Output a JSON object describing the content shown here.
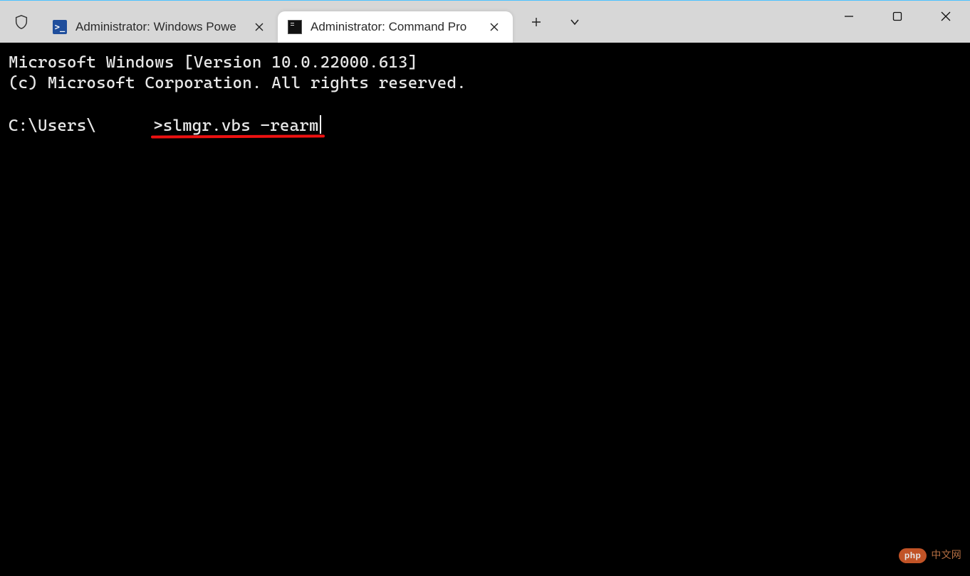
{
  "tabs": {
    "inactive": {
      "label": "Administrator: Windows Powe"
    },
    "active": {
      "label": "Administrator: Command Pro"
    }
  },
  "terminal": {
    "line1": "Microsoft Windows [Version 10.0.22000.613]",
    "line2": "(c) Microsoft Corporation. All rights reserved.",
    "prompt_prefix": "C:\\Users\\",
    "prompt_suffix": ">",
    "command": "slmgr.vbs -rearm"
  },
  "watermark": {
    "badge": "php",
    "text": "中文网"
  }
}
